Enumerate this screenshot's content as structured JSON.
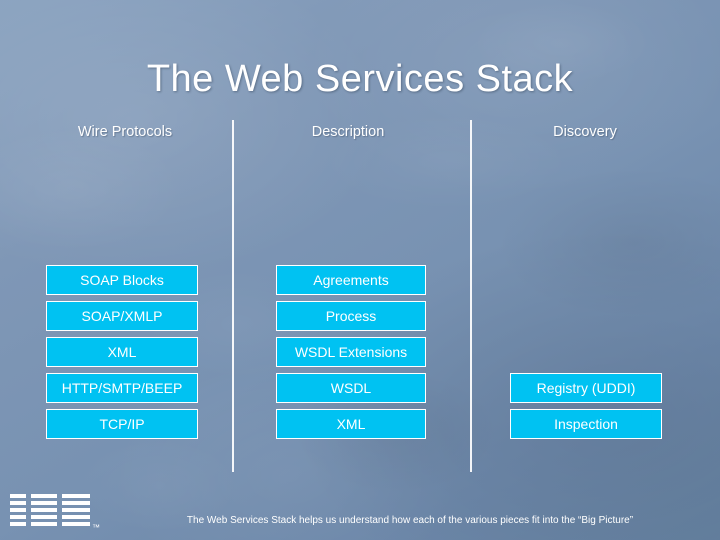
{
  "slide": {
    "title": "The Web Services Stack",
    "columns": [
      {
        "header": "Wire Protocols"
      },
      {
        "header": "Description"
      },
      {
        "header": "Discovery"
      }
    ],
    "rows": [
      {
        "wire": "SOAP Blocks",
        "description": "Agreements",
        "discovery": ""
      },
      {
        "wire": "SOAP/XMLP",
        "description": "Process",
        "discovery": ""
      },
      {
        "wire": "XML",
        "description": "WSDL Extensions",
        "discovery": ""
      },
      {
        "wire": "HTTP/SMTP/BEEP",
        "description": "WSDL",
        "discovery": "Registry (UDDI)"
      },
      {
        "wire": "TCP/IP",
        "description": "XML",
        "discovery": "Inspection"
      }
    ],
    "footer": "The Web Services Stack helps us understand how each of the various pieces fit into the “Big Picture”",
    "logo": {
      "text": "IBM",
      "trademark": "™"
    },
    "colors": {
      "cell_fill": "#00c2f2",
      "cell_border": "#ffffff",
      "text": "#ffffff",
      "background_top": "#8ba3c0",
      "background_bottom": "#64809f"
    }
  }
}
